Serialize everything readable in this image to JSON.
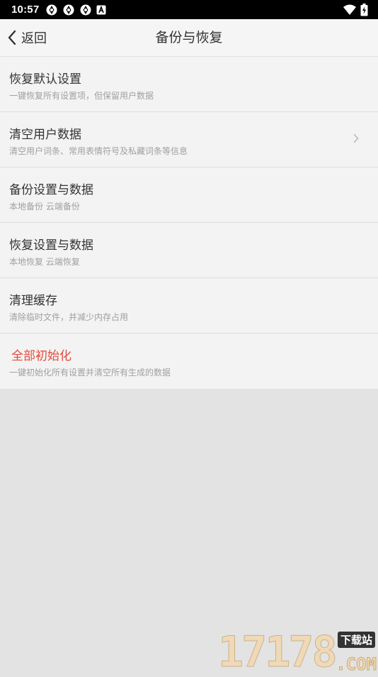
{
  "status_bar": {
    "time": "10:57",
    "left_icons": [
      "app-notification-icon",
      "app-notification-icon",
      "app-notification-icon",
      "a-badge-icon"
    ],
    "right_icons": [
      "wifi-icon",
      "battery-charging-icon"
    ]
  },
  "header": {
    "back_label": "返回",
    "title": "备份与恢复"
  },
  "settings": {
    "items": [
      {
        "title": "恢复默认设置",
        "desc": "一键恢复所有设置项，但保留用户数据"
      },
      {
        "title": "清空用户数据",
        "desc": "清空用户词条、常用表情符号及私藏词条等信息"
      },
      {
        "title": "备份设置与数据",
        "desc": "本地备份 云端备份"
      },
      {
        "title": "恢复设置与数据",
        "desc": "本地恢复 云端恢复"
      },
      {
        "title": "清理缓存",
        "desc": "清除临时文件，并减少内存占用"
      },
      {
        "title": "全部初始化",
        "desc": "一键初始化所有设置并清空所有生成的数据"
      }
    ]
  },
  "watermark": {
    "digits": "17178",
    "badge": "下载站",
    "suffix": ".COM"
  },
  "colors": {
    "danger": "#e74a3b",
    "background": "#e3e3e3",
    "list_background": "#f3f3f3"
  }
}
